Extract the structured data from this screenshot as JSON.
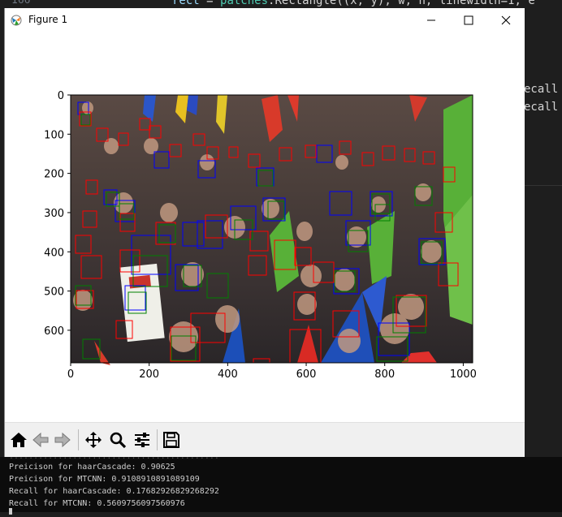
{
  "editor": {
    "line_number": "166",
    "code_line": {
      "var": "rect",
      "op": " = ",
      "obj": "patches",
      "call": ".Rectangle((x, y), w, h, linewidth=1, e"
    },
    "right_fragments": [
      "ecall",
      "ecall"
    ]
  },
  "window": {
    "title": "Figure 1",
    "icons": {
      "app": "matplotlib-icon",
      "minimize": "minimize-icon",
      "maximize": "maximize-icon",
      "close": "close-icon"
    }
  },
  "plot": {
    "x_ticks": [
      "0",
      "200",
      "400",
      "600",
      "800",
      "1000"
    ],
    "y_ticks": [
      "0",
      "100",
      "200",
      "300",
      "400",
      "500",
      "600"
    ],
    "image": {
      "width": 1024,
      "height": 683,
      "description_icon": "crowd-photo"
    },
    "box_colors": {
      "haar": "#0000ff",
      "mtcnn": "#ff0000",
      "ground_truth": "#008000"
    }
  },
  "toolbar": {
    "buttons": [
      {
        "name": "home-button",
        "icon": "home-icon"
      },
      {
        "name": "back-button",
        "icon": "back-arrow-icon"
      },
      {
        "name": "forward-button",
        "icon": "forward-arrow-icon"
      },
      {
        "name": "pan-button",
        "icon": "move-icon"
      },
      {
        "name": "zoom-button",
        "icon": "zoom-icon"
      },
      {
        "name": "configure-subplots-button",
        "icon": "sliders-icon"
      },
      {
        "name": "save-button",
        "icon": "save-icon"
      }
    ]
  },
  "terminal": {
    "partial_line": "...........................................",
    "lines": [
      "Preicison for haarCascade: 0.90625",
      "Preicison for MTCNN: 0.9108910891089109",
      "Recall for haarCascade: 0.17682926829268292",
      "Recall for MTCNN: 0.5609756097560976"
    ]
  }
}
